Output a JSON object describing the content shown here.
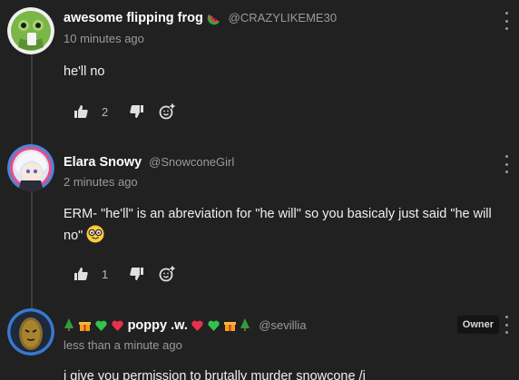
{
  "comments": [
    {
      "username": "awesome flipping frog",
      "handle": "@CRAZYLIKEME30",
      "timestamp": "10 minutes ago",
      "body": "he'll no",
      "like_count": "2"
    },
    {
      "username": "Elara Snowy",
      "handle": "@SnowconeGirl",
      "timestamp": "2 minutes ago",
      "body_line1": "ERM- \"he'll\" is an abreviation for \"he will\" so you basicaly just said \"he will",
      "body_line2": "no\"",
      "like_count": "1"
    },
    {
      "username": "poppy .w.",
      "handle": "@sevillia",
      "timestamp": "less than a minute ago",
      "badge": "Owner",
      "body": "i give you permission to brutally murder snowcone /j"
    }
  ],
  "icons": {
    "like": "thumbs-up-icon",
    "dislike": "thumbs-down-icon",
    "react": "add-emoji-icon",
    "menu": "more-vertical-icon"
  },
  "colors": {
    "background": "#212121",
    "text": "#e8e8e8",
    "muted": "#9a9a9a"
  }
}
